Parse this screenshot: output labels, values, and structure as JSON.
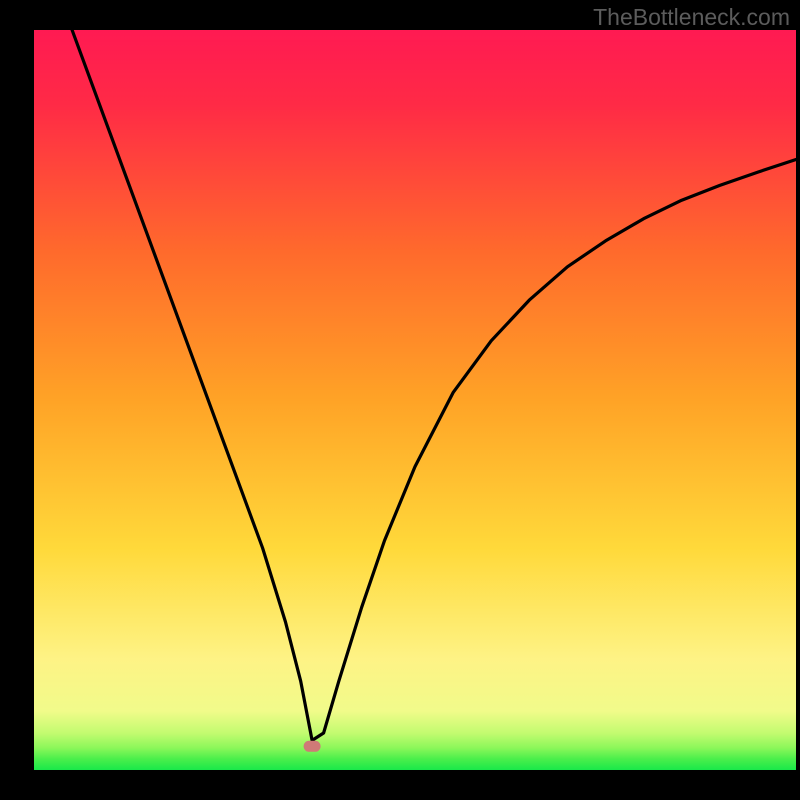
{
  "watermark": "TheBottleneck.com",
  "chart_data": {
    "type": "line",
    "title": "",
    "xlabel": "",
    "ylabel": "",
    "xlim": [
      0,
      100
    ],
    "ylim": [
      0,
      100
    ],
    "series": [
      {
        "name": "curve",
        "x": [
          5,
          10,
          15,
          20,
          25,
          30,
          33,
          35,
          36.5,
          38,
          40,
          43,
          46,
          50,
          55,
          60,
          65,
          70,
          75,
          80,
          85,
          90,
          95,
          100
        ],
        "y": [
          100,
          86,
          72,
          58,
          44,
          30,
          20,
          12,
          4,
          5,
          12,
          22,
          31,
          41,
          51,
          58,
          63.5,
          68,
          71.5,
          74.5,
          77,
          79,
          80.8,
          82.5
        ]
      }
    ],
    "marker": {
      "x": 36.5,
      "y": 3.2
    },
    "gradient_bands": [
      {
        "y": 0.0,
        "color": "#19e84a"
      },
      {
        "y": 1.5,
        "color": "#4bef4b"
      },
      {
        "y": 3.0,
        "color": "#8cf75a"
      },
      {
        "y": 5.0,
        "color": "#c3fb70"
      },
      {
        "y": 8.0,
        "color": "#f1fb8a"
      },
      {
        "y": 15.0,
        "color": "#fef385"
      },
      {
        "y": 30.0,
        "color": "#ffd93a"
      },
      {
        "y": 50.0,
        "color": "#ffa326"
      },
      {
        "y": 70.0,
        "color": "#ff6a2c"
      },
      {
        "y": 90.0,
        "color": "#ff2a46"
      },
      {
        "y": 100.0,
        "color": "#ff1a52"
      }
    ]
  }
}
